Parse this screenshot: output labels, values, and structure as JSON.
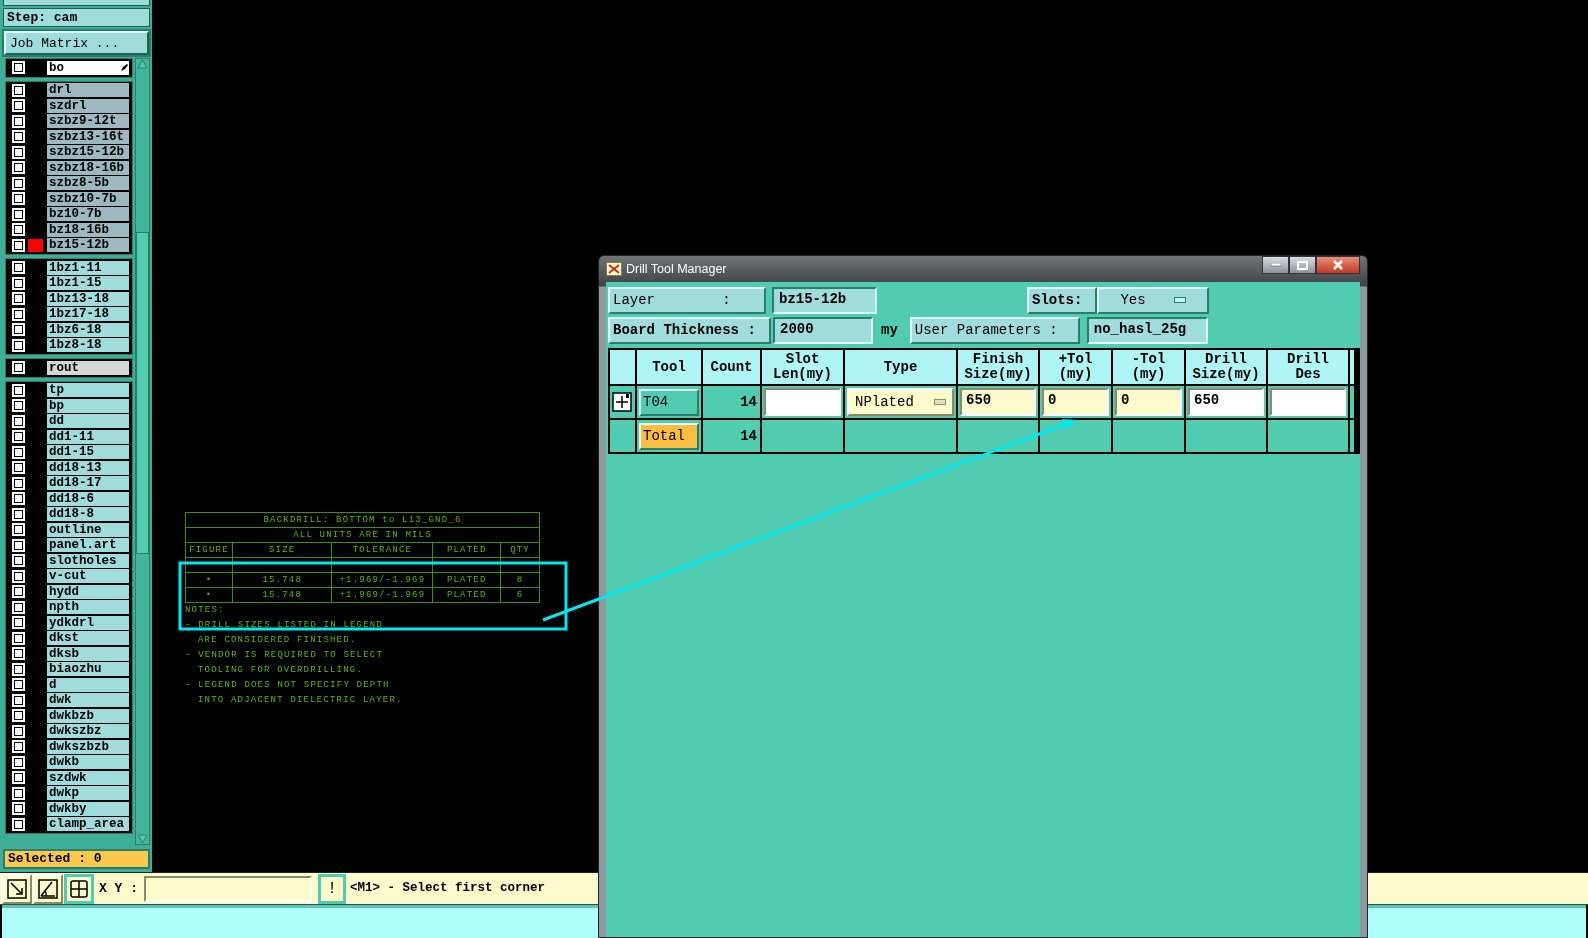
{
  "job_panel": {
    "step": "Step: cam",
    "matrix_button": "Job Matrix ...",
    "layer_groups": [
      {
        "kind": "board",
        "layers": [
          {
            "name": "bo",
            "checked": false
          }
        ]
      },
      {
        "kind": "drill",
        "layers": [
          {
            "name": "drl",
            "checked": false
          },
          {
            "name": "szdrl",
            "checked": false
          },
          {
            "name": "szbz9-12t",
            "checked": false
          },
          {
            "name": "szbz13-16t",
            "checked": false
          },
          {
            "name": "szbz15-12b",
            "checked": false
          },
          {
            "name": "szbz18-16b",
            "checked": false
          },
          {
            "name": "szbz8-5b",
            "checked": false
          },
          {
            "name": "szbz10-7b",
            "checked": false
          },
          {
            "name": "bz10-7b",
            "checked": false
          },
          {
            "name": "bz18-16b",
            "checked": false
          },
          {
            "name": "bz15-12b",
            "checked": false,
            "color": "#ff0000"
          }
        ]
      },
      {
        "kind": "drill_set",
        "layers": [
          {
            "name": "1bz1-11",
            "checked": false
          },
          {
            "name": "1bz1-15",
            "checked": false
          },
          {
            "name": "1bz13-18",
            "checked": false
          },
          {
            "name": "1bz17-18",
            "checked": false
          },
          {
            "name": "1bz6-18",
            "checked": false
          },
          {
            "name": "1bz8-18",
            "checked": false
          }
        ]
      },
      {
        "kind": "rout",
        "layers": [
          {
            "name": "rout",
            "checked": false
          }
        ]
      },
      {
        "kind": "document",
        "layers": [
          {
            "name": "tp",
            "checked": false
          },
          {
            "name": "bp",
            "checked": false
          },
          {
            "name": "dd",
            "checked": false
          },
          {
            "name": "dd1-11",
            "checked": false
          },
          {
            "name": "dd1-15",
            "checked": false
          },
          {
            "name": "dd18-13",
            "checked": false
          },
          {
            "name": "dd18-17",
            "checked": false
          },
          {
            "name": "dd18-6",
            "checked": false
          },
          {
            "name": "dd18-8",
            "checked": false
          },
          {
            "name": "outline",
            "checked": false
          },
          {
            "name": "panel.art",
            "checked": false
          },
          {
            "name": "slotholes",
            "checked": false
          },
          {
            "name": "v-cut",
            "checked": false
          },
          {
            "name": "hydd",
            "checked": false
          },
          {
            "name": "npth",
            "checked": false
          },
          {
            "name": "ydkdrl",
            "checked": false
          },
          {
            "name": "dkst",
            "checked": false
          },
          {
            "name": "dksb",
            "checked": false
          },
          {
            "name": "biaozhu",
            "checked": false
          },
          {
            "name": "d",
            "checked": false
          },
          {
            "name": "dwk",
            "checked": false
          },
          {
            "name": "dwkbzb",
            "checked": false
          },
          {
            "name": "dwkszbz",
            "checked": false
          },
          {
            "name": "dwkszbzb",
            "checked": false
          },
          {
            "name": "dwkb",
            "checked": false
          },
          {
            "name": "szdwk",
            "checked": false
          },
          {
            "name": "dwkp",
            "checked": false
          },
          {
            "name": "dwkby",
            "checked": false
          },
          {
            "name": "clamp_area",
            "checked": false
          }
        ]
      }
    ],
    "selected": "Selected : 0"
  },
  "legend": {
    "title": "BACKDRILL: BOTTOM to L13_GND_6",
    "subtitle": "ALL UNITS ARE IN MILS",
    "columns": [
      "FIGURE",
      "SIZE",
      "TOLERANCE",
      "PLATED",
      "QTY"
    ],
    "rows": [
      {
        "cells": [
          "•",
          "15.748",
          "+1.969/-1.969",
          "PLATED",
          "8"
        ]
      },
      {
        "cells": [
          "•",
          "15.748",
          "+1.969/-1.969",
          "PLATED",
          "6"
        ]
      }
    ],
    "notes_title": "NOTES:",
    "notes": [
      {
        "kind": "bullet",
        "text": "- DRILL SIZES LISTED IN LEGEND"
      },
      {
        "kind": "continuation",
        "text": "ARE CONSIDERED FINISHED."
      },
      {
        "kind": "bullet",
        "text": "- VENDOR IS REQUIRED TO SELECT"
      },
      {
        "kind": "continuation",
        "text": "TOOLING FOR OVERDRILLING."
      },
      {
        "kind": "bullet",
        "text": "- LEGEND DOES NOT SPECIFY DEPTH"
      },
      {
        "kind": "continuation",
        "text": "INTO ADJACENT DIELECTRIC LAYER."
      }
    ]
  },
  "dialog": {
    "title": "Drill Tool Manager",
    "layer_label": "Layer        :",
    "layer": "bz15-12b",
    "slots_label": "Slots:",
    "slots": "Yes",
    "thickness_label": "Board Thickness :",
    "thickness": "2000",
    "thickness_unit": "my",
    "user_params_button": "User Parameters :",
    "user_params": "no_hasl_25g",
    "columns": [
      "Tool",
      "Count",
      "Slot\nLen(my)",
      "Type",
      "Finish\nSize(my)",
      "+Tol\n(my)",
      "-Tol\n(my)",
      "Drill\nSize(my)",
      "Drill\nDes"
    ],
    "rows": [
      {
        "kind": "tool",
        "tool": "T04",
        "count": "14",
        "type": "NPlated",
        "finish_size": "650",
        "plus_tol": "0",
        "minus_tol": "0",
        "drill_size": "650"
      },
      {
        "kind": "total",
        "tool": "Total",
        "count": "14"
      }
    ]
  },
  "toolbar": {
    "tools": [
      {
        "kind": "zoom",
        "selected": false
      },
      {
        "kind": "angle",
        "selected": false
      },
      {
        "kind": "grid",
        "selected": true
      }
    ],
    "xy_label": "X Y :",
    "message_icon": "!",
    "message": "<M1> - Select first corner"
  }
}
